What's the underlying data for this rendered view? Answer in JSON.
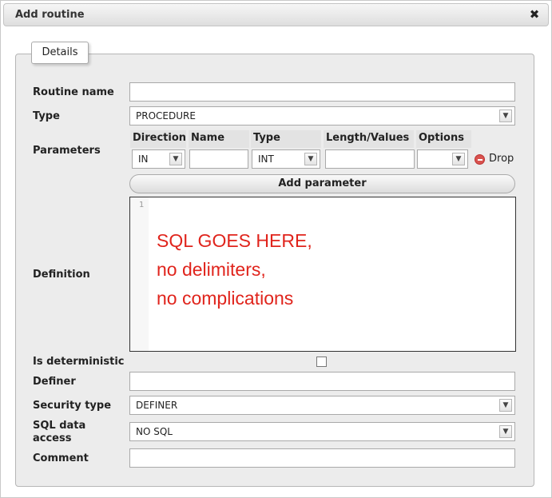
{
  "dialog": {
    "title": "Add routine",
    "close_glyph": "✖"
  },
  "fieldset": {
    "legend": "Details"
  },
  "labels": {
    "routine_name": "Routine name",
    "type": "Type",
    "parameters": "Parameters",
    "definition": "Definition",
    "is_deterministic": "Is deterministic",
    "definer": "Definer",
    "security_type": "Security type",
    "sql_data_access_line1": "SQL data",
    "sql_data_access_line2": "access",
    "comment": "Comment"
  },
  "values": {
    "routine_name": "",
    "type": "PROCEDURE",
    "definer": "",
    "security_type": "DEFINER",
    "sql_data_access": "NO SQL",
    "comment": "",
    "is_deterministic": false
  },
  "params": {
    "headers": [
      "Direction",
      "Name",
      "Type",
      "Length/Values",
      "Options"
    ],
    "row": {
      "direction": "IN",
      "name": "",
      "type": "INT",
      "length": "",
      "options": ""
    },
    "drop_label": "Drop",
    "add_label": "Add parameter"
  },
  "editor": {
    "line_number": "1",
    "lines": [
      "SQL GOES HERE,",
      "no delimiters,",
      "no complications"
    ],
    "text_color": "#e0241c"
  },
  "icons": {
    "close": "close-icon",
    "drop": "drop-icon",
    "dropdown": "chevron-down-icon"
  }
}
